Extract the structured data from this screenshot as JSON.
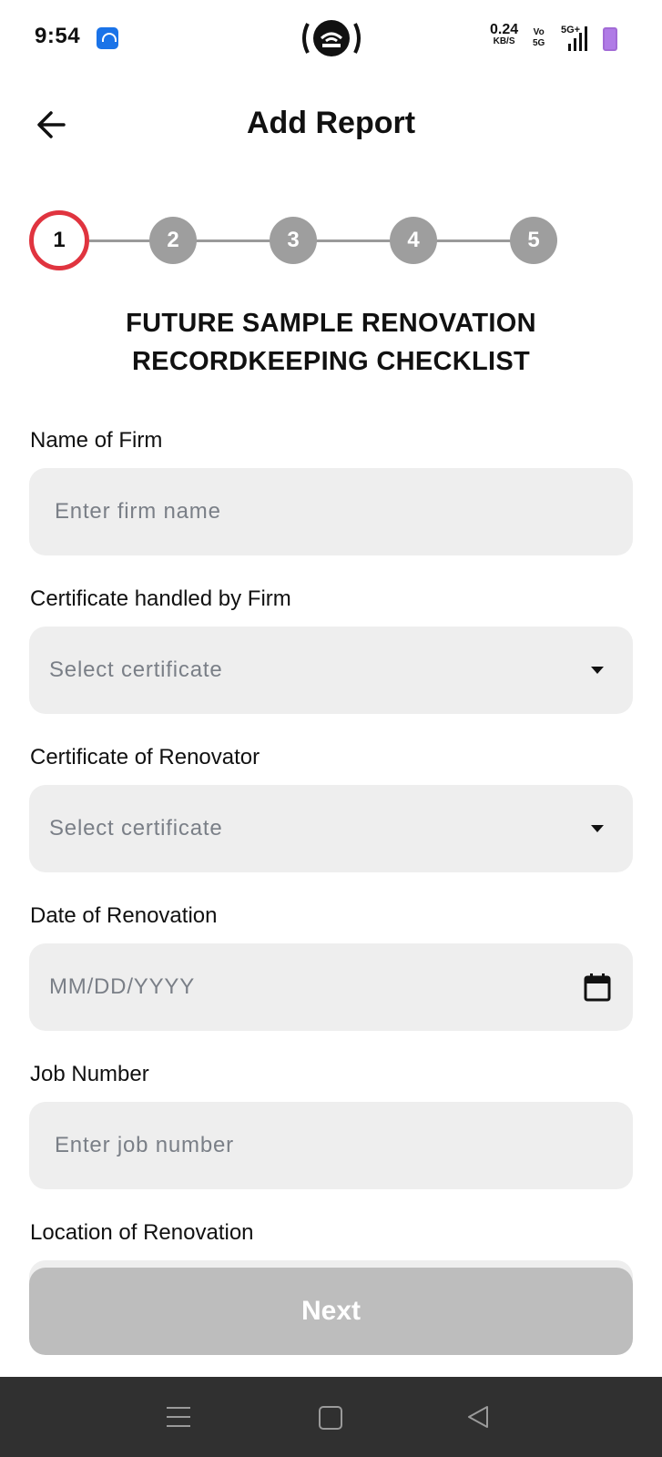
{
  "status_bar": {
    "time": "9:54",
    "network_speed": "0.24",
    "network_speed_unit": "KB/S",
    "volte_top": "Vo",
    "volte_bottom": "5G",
    "signal_label": "5G+",
    "icons": [
      "app-notification-icon",
      "hotspot-icon",
      "signal-icon",
      "battery-charging-icon"
    ]
  },
  "header": {
    "title": "Add Report",
    "back_icon": "arrow-left-icon"
  },
  "stepper": {
    "steps": [
      "1",
      "2",
      "3",
      "4",
      "5"
    ],
    "active_step": 1,
    "active_color": "#e0343f",
    "inactive_color": "#9e9e9e"
  },
  "form": {
    "title_line1": "FUTURE SAMPLE RENOVATION",
    "title_line2": "RECORDKEEPING CHECKLIST",
    "fields": {
      "firm_name": {
        "label": "Name of Firm",
        "placeholder": "Enter firm name",
        "value": ""
      },
      "firm_certificate": {
        "label": "Certificate handled by Firm",
        "placeholder": "Select certificate",
        "icon": "chevron-down-icon"
      },
      "renovator_certificate": {
        "label": "Certificate of Renovator",
        "placeholder": "Select certificate",
        "icon": "chevron-down-icon"
      },
      "renovation_date": {
        "label": "Date of Renovation",
        "placeholder": "MM/DD/YYYY",
        "icon": "calendar-icon"
      },
      "job_number": {
        "label": "Job Number",
        "placeholder": "Enter job number",
        "value": ""
      },
      "location": {
        "label": "Location of Renovation"
      }
    },
    "next_label": "Next",
    "next_color": "#bdbdbd"
  },
  "nav_bar": {
    "icons": [
      "menu-icon",
      "home-icon",
      "back-triangle-icon"
    ]
  }
}
